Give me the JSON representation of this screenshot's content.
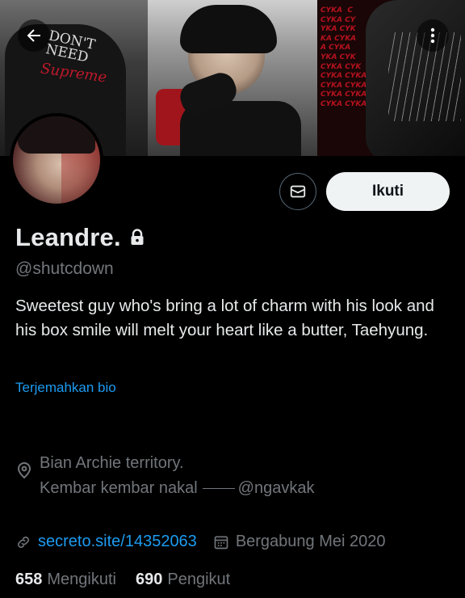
{
  "header": {
    "back_icon": "arrow-left-icon",
    "more_icon": "more-vertical-icon",
    "banner_text": {
      "dont_need": "DON'T\nNEED",
      "brand": "Supreme",
      "cyka_lines": "CYKA  C\nCYKA CY\nYKA CYK\nKA CYKA\nA CYKA\nYKA CYK\nCYKA CYK\nCYKA CYKA\nCYKA CYKA\nCYKA CYKA CYKA\nCYKA CYKA CYKA"
    }
  },
  "actions": {
    "message_icon": "mail-icon",
    "follow_label": "Ikuti"
  },
  "profile": {
    "display_name": "Leandre.",
    "lock_icon": "lock-icon",
    "handle": "@shutcdown",
    "bio": "Sweetest guy who's bring a lot of charm with his look and his box smile will melt your heart like a butter, Taehyung.",
    "translate_label": "Terjemahkan bio",
    "location_line1": "Bian Archie territory.",
    "location_line2_a": "Kembar kembar nakal",
    "location_line2_b": "@ngavkak",
    "website": "secreto.site/14352063",
    "joined": "Bergabung Mei 2020",
    "following_count": "658",
    "following_label": "Mengikuti",
    "followers_count": "690",
    "followers_label": "Pengikut"
  },
  "colors": {
    "background": "#000000",
    "text_primary": "#e7e9ea",
    "text_secondary": "#71767b",
    "link": "#1d9bf0",
    "follow_button_bg": "#eff3f4"
  }
}
